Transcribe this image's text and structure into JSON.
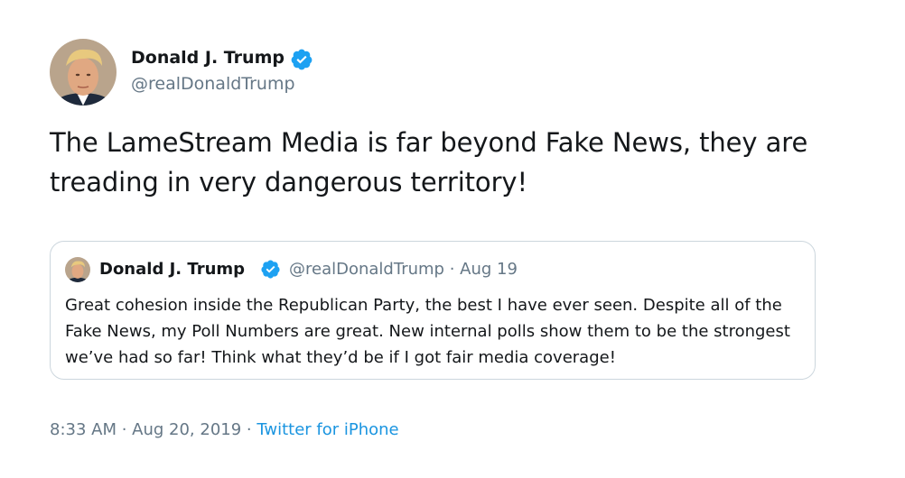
{
  "author": {
    "name": "Donald J. Trump",
    "handle": "@realDonaldTrump",
    "verified": true
  },
  "tweet": {
    "text": "The LameStream Media is far beyond Fake News, they are treading in very dangerous territory!"
  },
  "quoted_tweet": {
    "name": "Donald J. Trump",
    "verified": true,
    "meta": "@realDonaldTrump · Aug 19",
    "text": "Great cohesion inside the Republican Party, the best I have ever seen. Despite all of the Fake News, my Poll Numbers are great. New internal polls show them to be the strongest we’ve had so far! Think what they’d be if I got fair media coverage!"
  },
  "footer": {
    "timestamp": "8:33 AM · Aug 20, 2019 · ",
    "source": "Twitter for iPhone"
  },
  "colors": {
    "verified_blue": "#1da1f2",
    "link_blue": "#1b95e0",
    "secondary_text": "#657786",
    "border": "#ccd6dd"
  },
  "icons": {
    "verified": "verified-badge-icon",
    "avatar": "profile-photo"
  }
}
